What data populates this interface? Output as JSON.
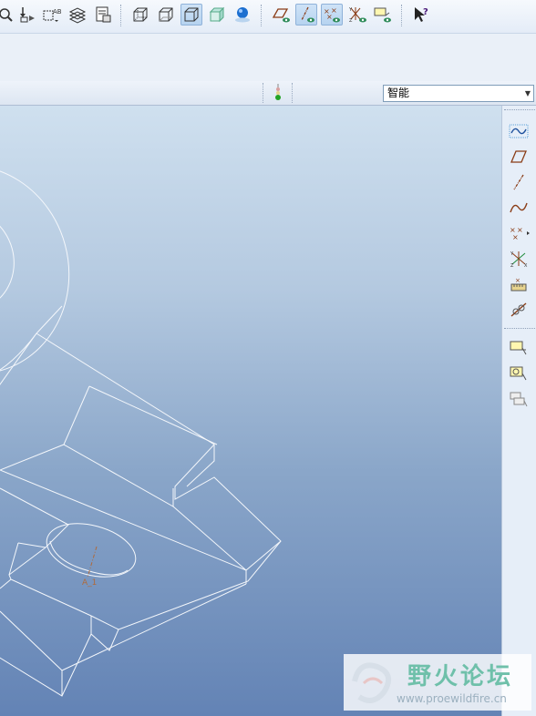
{
  "toolbar": {
    "buttons": [
      {
        "name": "zoom-icon",
        "label": ""
      },
      {
        "name": "regenerate-icon",
        "label": ""
      },
      {
        "name": "rename-icon",
        "label": "AB"
      },
      {
        "name": "layers-icon",
        "label": ""
      },
      {
        "name": "model-tree-icon",
        "label": ""
      },
      {
        "name": "wireframe-icon",
        "label": ""
      },
      {
        "name": "hidden-line-icon",
        "label": ""
      },
      {
        "name": "no-hidden-icon",
        "label": ""
      },
      {
        "name": "shading-icon",
        "label": ""
      },
      {
        "name": "appearance-icon",
        "label": ""
      },
      {
        "name": "datum-plane-display-icon",
        "label": ""
      },
      {
        "name": "datum-axis-display-icon",
        "label": ""
      },
      {
        "name": "datum-point-display-icon",
        "label": ""
      },
      {
        "name": "coordinate-system-display-icon",
        "label": ""
      },
      {
        "name": "annotation-display-icon",
        "label": ""
      },
      {
        "name": "context-help-icon",
        "label": "?"
      }
    ]
  },
  "status": {
    "filter_value": "智能",
    "traffic_light": "ready"
  },
  "right_toolbar": {
    "tools": [
      "sketch-tool-icon",
      "datum-plane-tool-icon",
      "datum-axis-tool-icon",
      "datum-curve-tool-icon",
      "datum-point-tool-icon",
      "coordinate-system-tool-icon",
      "analysis-tool-icon",
      "insert-datum-tool-icon",
      "annotation-tool-icon",
      "note-tool-icon",
      "annotation-group-icon"
    ]
  },
  "viewport": {
    "axis_label": "A_1"
  },
  "watermark": {
    "title": "野火论坛",
    "url": "www.proewildfire.cn"
  }
}
